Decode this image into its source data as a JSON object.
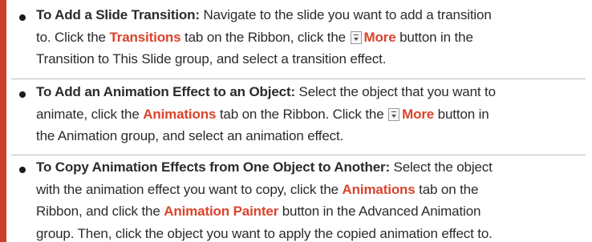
{
  "items": [
    {
      "heading": "To Add a Slide Transition:",
      "lines": [
        [
          {
            "t": "To Add a Slide Transition:",
            "s": "bold"
          },
          {
            "t": " Navigate to the slide you want to add a transition",
            "s": ""
          }
        ],
        [
          {
            "t": "to. Click the ",
            "s": ""
          },
          {
            "t": "Transitions",
            "s": "red"
          },
          {
            "t": " tab on the Ribbon, click the ",
            "s": ""
          },
          {
            "icon": "more-gallery-icon"
          },
          {
            "t": "More",
            "s": "red"
          },
          {
            "t": " button in the",
            "s": ""
          }
        ],
        [
          {
            "t": "Transition to This Slide group, and select a transition effect.",
            "s": ""
          }
        ]
      ]
    },
    {
      "heading": "To Add an Animation Effect to an Object:",
      "lines": [
        [
          {
            "t": "To Add an Animation Effect to an Object:",
            "s": "bold"
          },
          {
            "t": " Select the object that you want to",
            "s": ""
          }
        ],
        [
          {
            "t": "animate, click the ",
            "s": ""
          },
          {
            "t": "Animations",
            "s": "red"
          },
          {
            "t": " tab on the Ribbon. Click the ",
            "s": ""
          },
          {
            "icon": "more-gallery-icon"
          },
          {
            "t": "More",
            "s": "red"
          },
          {
            "t": " button in",
            "s": ""
          }
        ],
        [
          {
            "t": "the Animation group, and select an animation effect.",
            "s": ""
          }
        ]
      ]
    },
    {
      "heading": "To Copy Animation Effects from One Object to Another:",
      "lines": [
        [
          {
            "t": "To Copy Animation Effects from One Object to Another:",
            "s": "bold"
          },
          {
            "t": " Select the object",
            "s": ""
          }
        ],
        [
          {
            "t": "with the animation effect you want to copy, click the ",
            "s": ""
          },
          {
            "t": "Animations",
            "s": "red"
          },
          {
            "t": " tab on the",
            "s": ""
          }
        ],
        [
          {
            "t": "Ribbon, and click the ",
            "s": ""
          },
          {
            "t": "Animation Painter",
            "s": "red"
          },
          {
            "t": " button in the Advanced Animation",
            "s": ""
          }
        ],
        [
          {
            "t": "group. Then, click the object you want to apply the copied animation effect to.",
            "s": ""
          }
        ]
      ]
    }
  ],
  "colors": {
    "accent": "#d9442c",
    "rule": "#cc3e2e",
    "text": "#2b2b2b",
    "separator": "#bfbfbf"
  }
}
